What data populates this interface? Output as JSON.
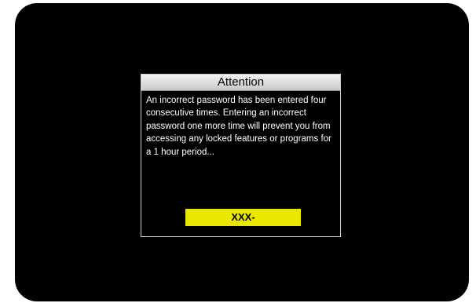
{
  "dialog": {
    "title": "Attention",
    "message": "An incorrect password has been entered four consecutive times. Entering an incorrect password one more time will prevent you from accessing any locked features or programs for a 1 hour period...",
    "pin_value": "XXX-"
  },
  "colors": {
    "screen_background": "#000000",
    "pin_field_background": "#e8e800",
    "dialog_border": "#d0d0d0"
  }
}
